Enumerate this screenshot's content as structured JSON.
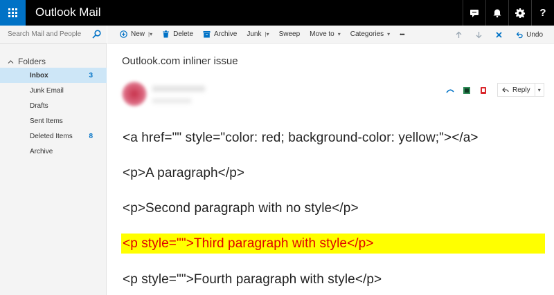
{
  "app": {
    "title": "Outlook Mail"
  },
  "colors": {
    "brand_blue": "#0072c6",
    "topbar": "#000000",
    "highlight_bg": "#ffff00",
    "highlight_text": "#e00000"
  },
  "topbar_icons": [
    "waffle-icon",
    "chat-icon",
    "bell-icon",
    "gear-icon",
    "help-icon"
  ],
  "top_help_label": "?",
  "search": {
    "placeholder": "Search Mail and People"
  },
  "folders": {
    "header": "Folders",
    "items": [
      {
        "label": "Inbox",
        "count": "3"
      },
      {
        "label": "Junk Email",
        "count": ""
      },
      {
        "label": "Drafts",
        "count": ""
      },
      {
        "label": "Sent Items",
        "count": ""
      },
      {
        "label": "Deleted Items",
        "count": "8"
      },
      {
        "label": "Archive",
        "count": ""
      }
    ]
  },
  "toolbar": {
    "new": "New",
    "delete": "Delete",
    "archive": "Archive",
    "junk": "Junk",
    "sweep": "Sweep",
    "move_to": "Move to",
    "categories": "Categories",
    "more": "•••",
    "undo": "Undo"
  },
  "message": {
    "subject": "Outlook.com inliner issue",
    "reply": "Reply",
    "lines": [
      "<a href=\"\" style=\"color: red; background-color: yellow;\"></a>",
      "<p>A paragraph</p>",
      "<p>Second paragraph with no style</p>",
      "<p style=\"\">Third paragraph with style</p>",
      "<p style=\"\">Fourth paragraph with style</p>"
    ]
  }
}
